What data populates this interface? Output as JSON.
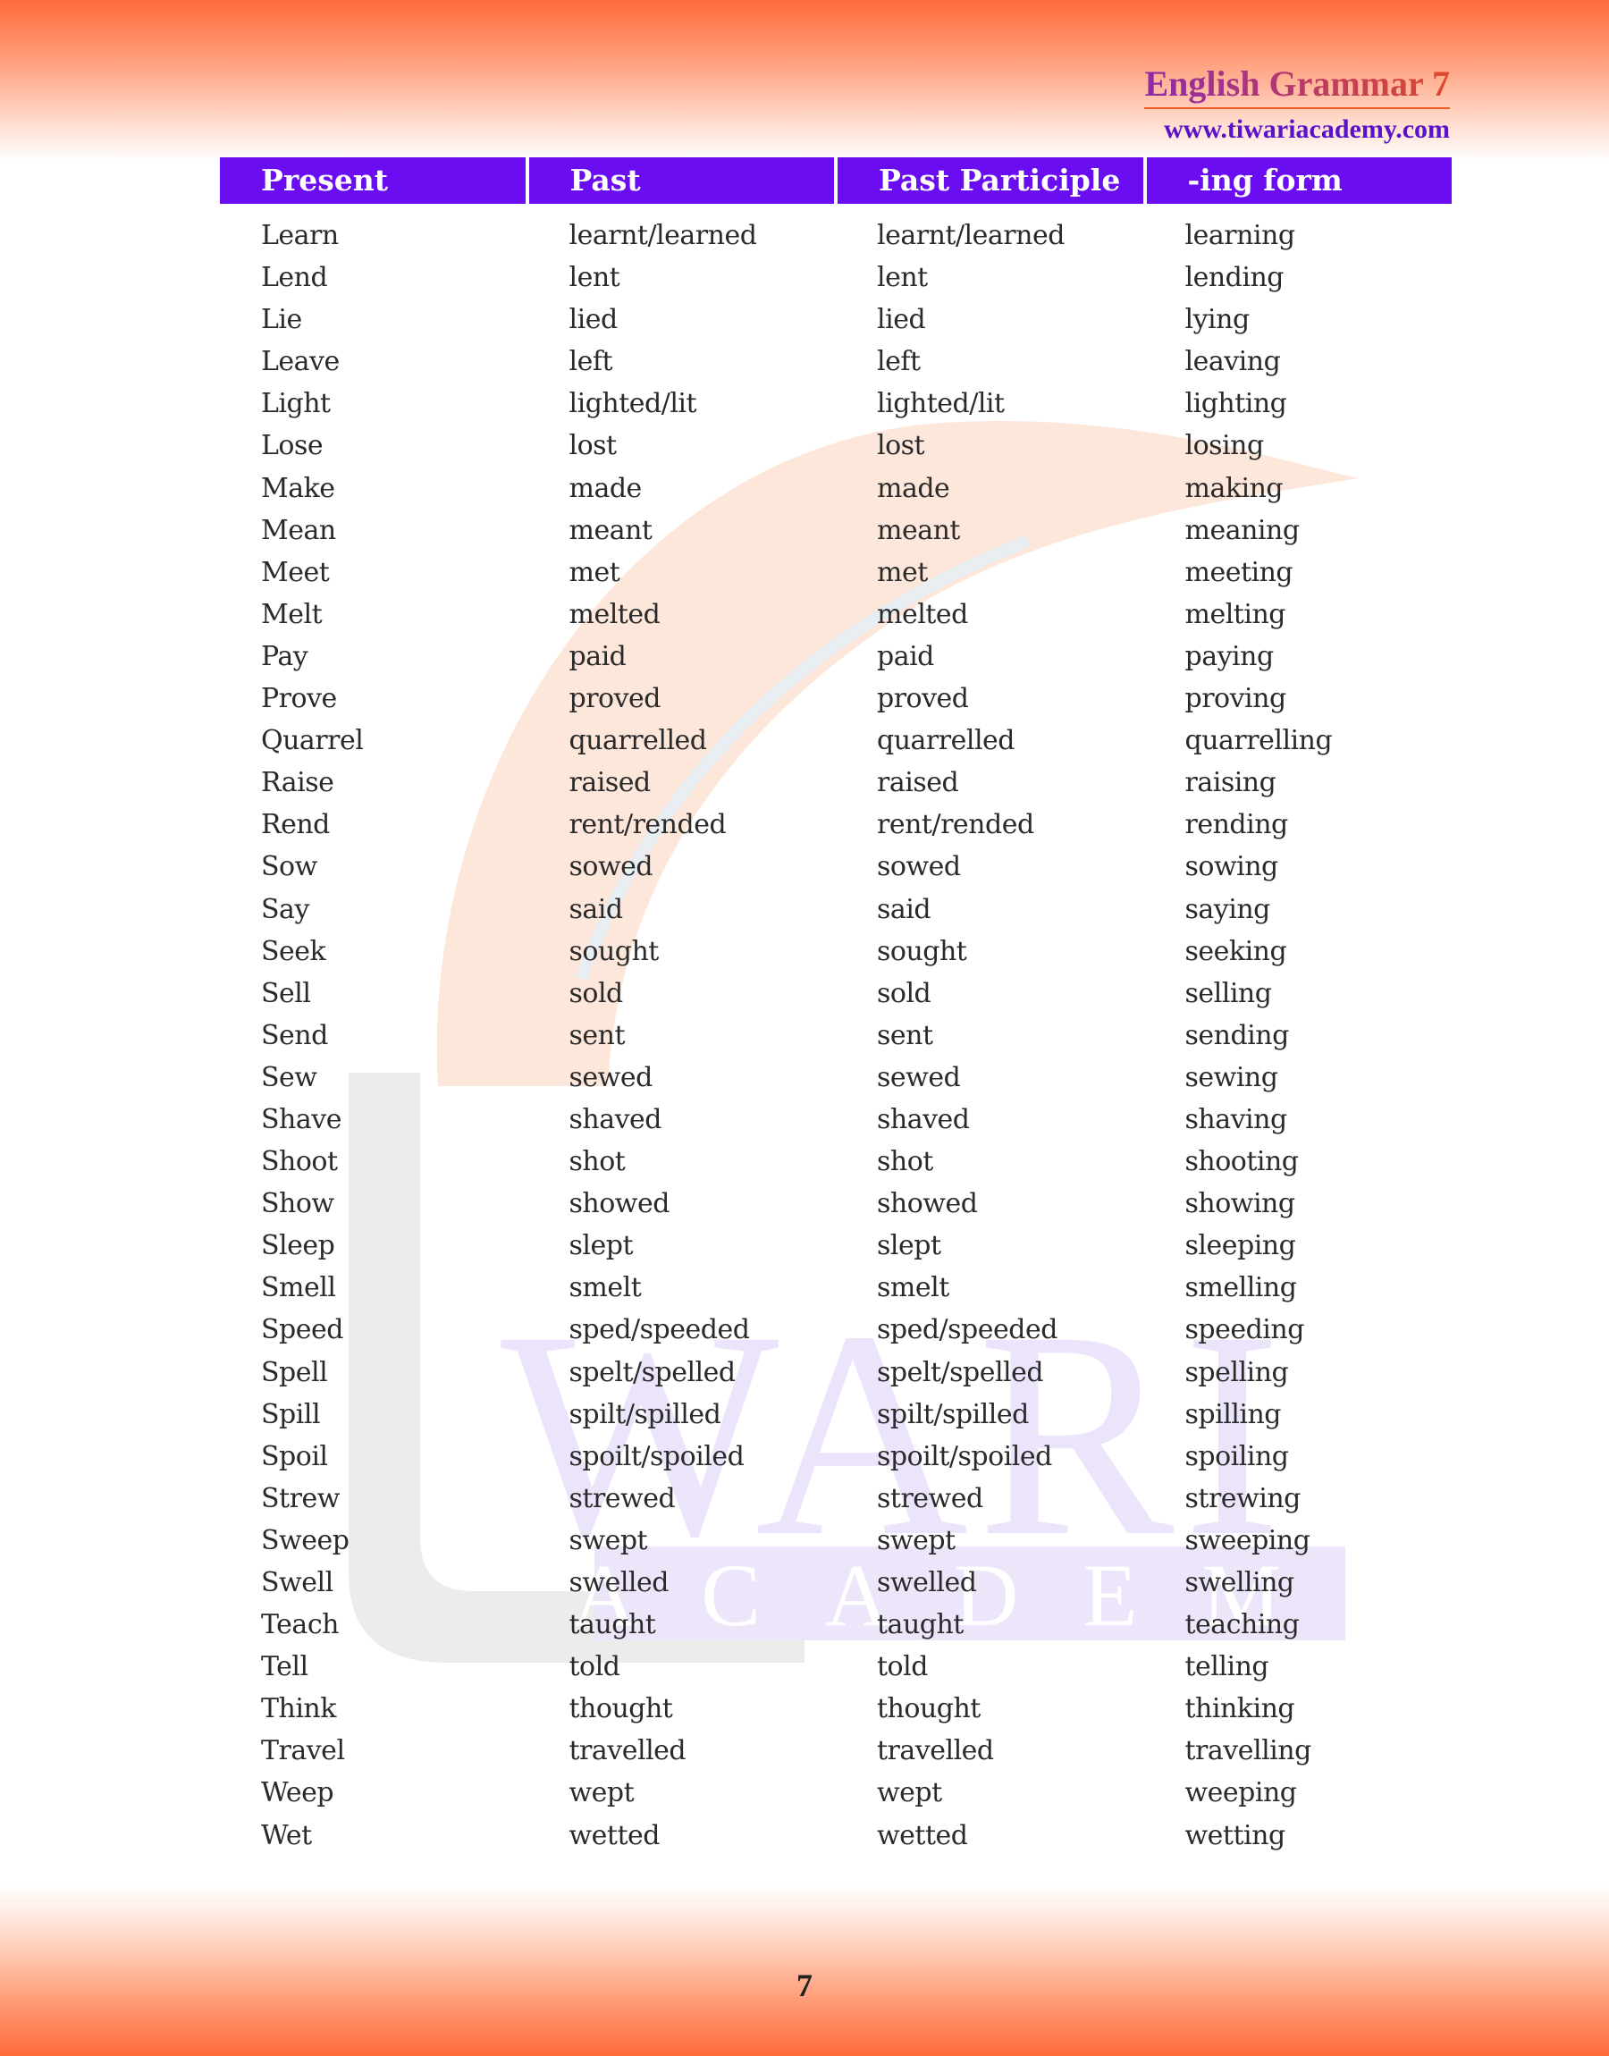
{
  "header": {
    "title": "English Grammar 7",
    "website": "www.tiwariacademy.com"
  },
  "watermark": {
    "word1": "WARI",
    "word2": "ACADEMY"
  },
  "table": {
    "columns": [
      "Present",
      "Past",
      "Past Participle",
      "-ing form"
    ],
    "rows": [
      [
        "Learn",
        "learnt/learned",
        "learnt/learned",
        "learning"
      ],
      [
        "Lend",
        "lent",
        "lent",
        "lending"
      ],
      [
        "Lie",
        "lied",
        "lied",
        "lying"
      ],
      [
        "Leave",
        "left",
        "left",
        "leaving"
      ],
      [
        "Light",
        "lighted/lit",
        "lighted/lit",
        "lighting"
      ],
      [
        "Lose",
        "lost",
        "lost",
        "losing"
      ],
      [
        "Make",
        "made",
        "made",
        "making"
      ],
      [
        "Mean",
        "meant",
        "meant",
        "meaning"
      ],
      [
        "Meet",
        "met",
        "met",
        "meeting"
      ],
      [
        "Melt",
        "melted",
        "melted",
        "melting"
      ],
      [
        "Pay",
        "paid",
        "paid",
        "paying"
      ],
      [
        "Prove",
        "proved",
        "proved",
        "proving"
      ],
      [
        "Quarrel",
        "quarrelled",
        "quarrelled",
        "quarrelling"
      ],
      [
        "Raise",
        "raised",
        "raised",
        "raising"
      ],
      [
        "Rend",
        "rent/rended",
        "rent/rended",
        "rending"
      ],
      [
        "Sow",
        "sowed",
        "sowed",
        "sowing"
      ],
      [
        "Say",
        "said",
        "said",
        "saying"
      ],
      [
        "Seek",
        "sought",
        "sought",
        "seeking"
      ],
      [
        "Sell",
        "sold",
        "sold",
        "selling"
      ],
      [
        "Send",
        "sent",
        "sent",
        "sending"
      ],
      [
        "Sew",
        "sewed",
        "sewed",
        "sewing"
      ],
      [
        "Shave",
        "shaved",
        "shaved",
        "shaving"
      ],
      [
        "Shoot",
        "shot",
        "shot",
        "shooting"
      ],
      [
        "Show",
        "showed",
        "showed",
        "showing"
      ],
      [
        "Sleep",
        "slept",
        "slept",
        "sleeping"
      ],
      [
        "Smell",
        "smelt",
        "smelt",
        "smelling"
      ],
      [
        "Speed",
        "sped/speeded",
        "sped/speeded",
        "speeding"
      ],
      [
        "Spell",
        "spelt/spelled",
        "spelt/spelled",
        "spelling"
      ],
      [
        "Spill",
        "spilt/spilled",
        "spilt/spilled",
        "spilling"
      ],
      [
        "Spoil",
        "spoilt/spoiled",
        "spoilt/spoiled",
        "spoiling"
      ],
      [
        "Strew",
        "strewed",
        "strewed",
        "strewing"
      ],
      [
        "Sweep",
        "swept",
        "swept",
        "sweeping"
      ],
      [
        "Swell",
        "swelled",
        "swelled",
        "swelling"
      ],
      [
        "Teach",
        "taught",
        "taught",
        "teaching"
      ],
      [
        "Tell",
        "told",
        "told",
        "telling"
      ],
      [
        "Think",
        "thought",
        "thought",
        "thinking"
      ],
      [
        "Travel",
        "travelled",
        "travelled",
        "travelling"
      ],
      [
        "Weep",
        "wept",
        "wept",
        "weeping"
      ],
      [
        "Wet",
        "wetted",
        "wetted",
        "wetting"
      ]
    ]
  },
  "footer": {
    "page_number": "7"
  },
  "colors": {
    "header_bar": "#6a0df0",
    "band_orange": "#ff6a3a",
    "url_purple": "#5a12c8"
  }
}
